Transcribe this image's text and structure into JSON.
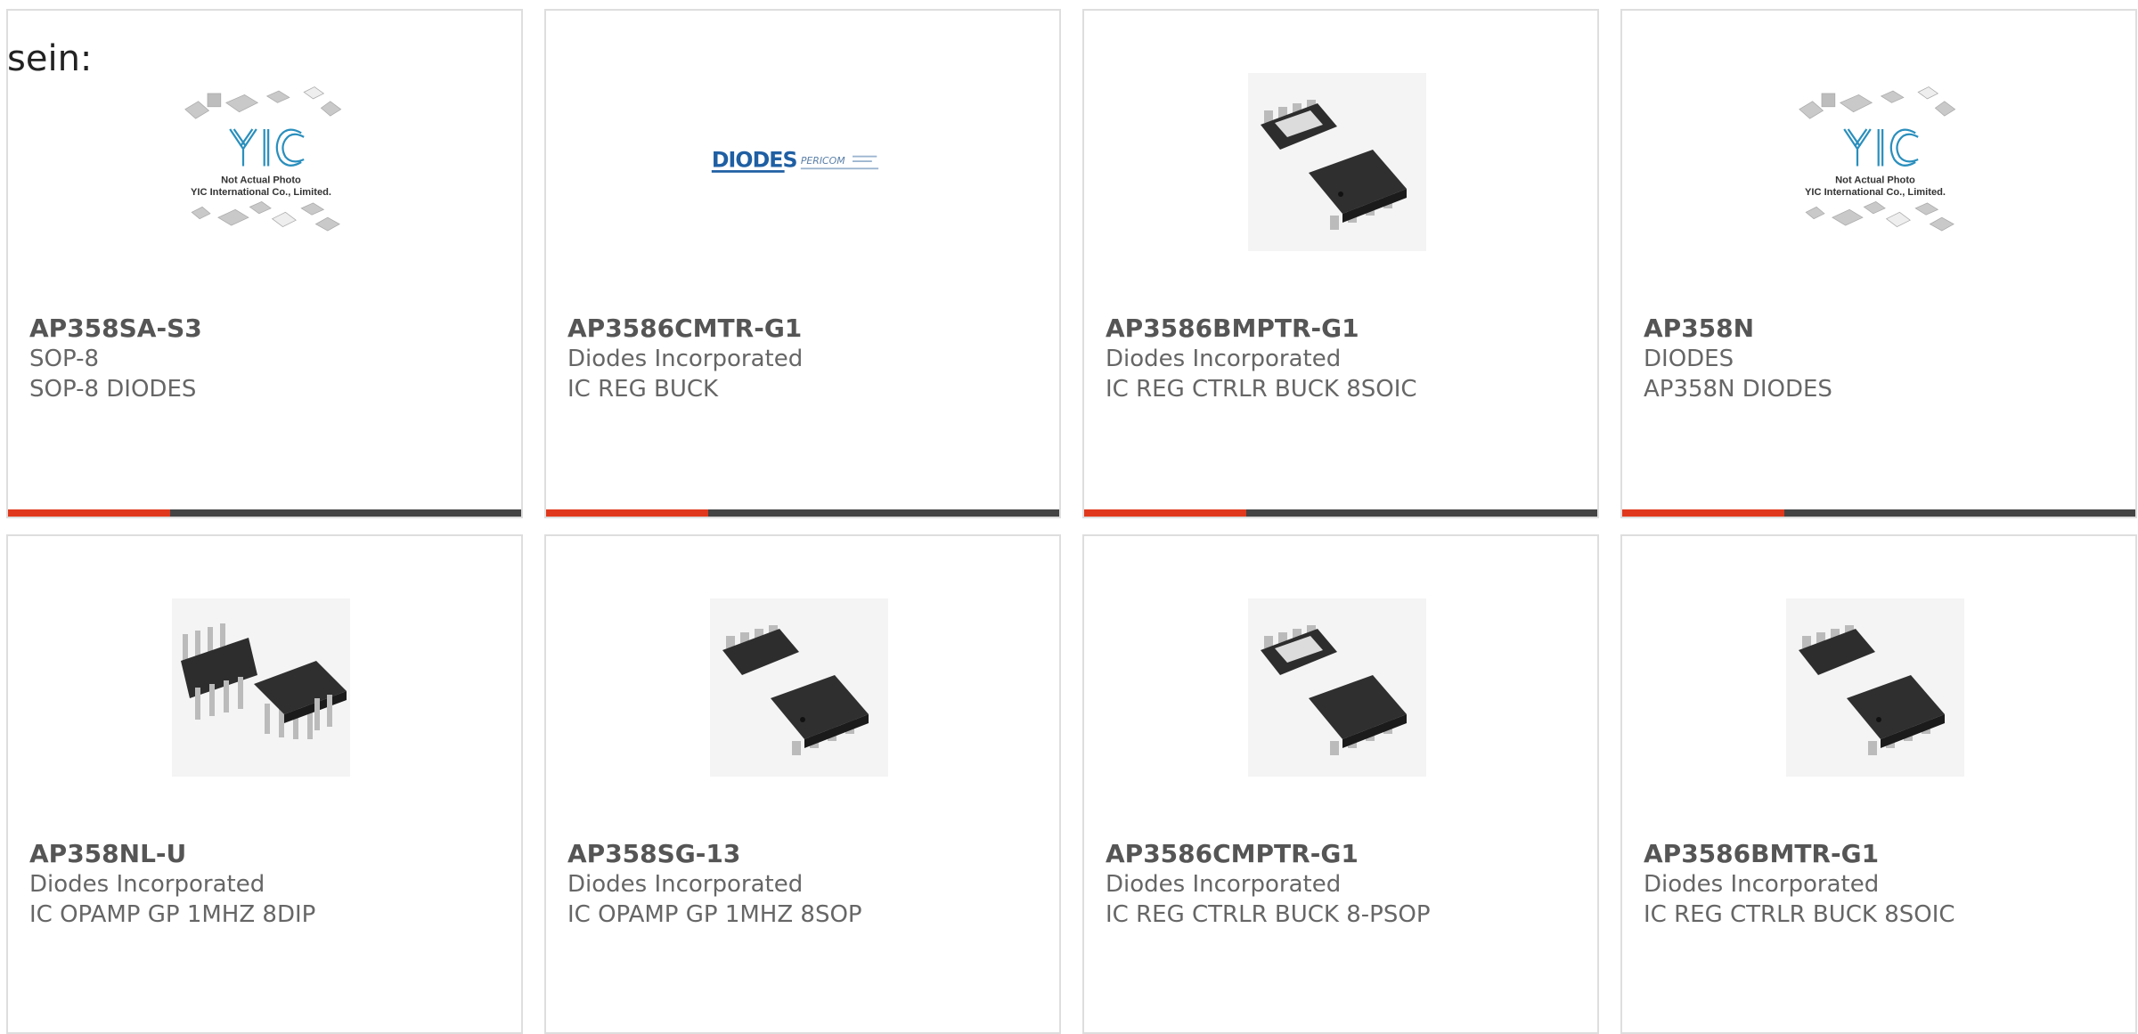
{
  "lead_text": "sein:",
  "products": [
    {
      "part": "AP358SA-S3",
      "line1": "SOP-8",
      "line2": "SOP-8 DIODES",
      "image": "yic-not-actual-photo",
      "image_caption_1": "Not Actual Photo",
      "image_caption_2": "YIC International Co., Limited."
    },
    {
      "part": "AP3586CMTR-G1",
      "line1": "Diodes Incorporated",
      "line2": "IC REG BUCK",
      "image": "diodes-pericom-logo",
      "logo_text_1": "DIODES",
      "logo_text_2": "PERICOM"
    },
    {
      "part": "AP3586BMPTR-G1",
      "line1": "Diodes Incorporated",
      "line2": "IC REG CTRLR BUCK 8SOIC",
      "image": "soic-8-chip-photo"
    },
    {
      "part": "AP358N",
      "line1": "DIODES",
      "line2": "AP358N DIODES",
      "image": "yic-not-actual-photo",
      "image_caption_1": "Not Actual Photo",
      "image_caption_2": "YIC International Co., Limited."
    },
    {
      "part": "AP358NL-U",
      "line1": "Diodes Incorporated",
      "line2": "IC OPAMP GP 1MHZ 8DIP",
      "image": "dip-8-chip-photo"
    },
    {
      "part": "AP358SG-13",
      "line1": "Diodes Incorporated",
      "line2": "IC OPAMP GP 1MHZ 8SOP",
      "image": "soic-8-chip-photo"
    },
    {
      "part": "AP3586CMPTR-G1",
      "line1": "Diodes Incorporated",
      "line2": "IC REG CTRLR BUCK 8-PSOP",
      "image": "soic-8-chip-photo"
    },
    {
      "part": "AP3586BMTR-G1",
      "line1": "Diodes Incorporated",
      "line2": "IC REG CTRLR BUCK 8SOIC",
      "image": "soic-8-chip-photo"
    }
  ],
  "colors": {
    "accent": "#e0381c",
    "bar": "#444444",
    "border": "#dedede",
    "title": "#555555",
    "text": "#666666",
    "logo_blue": "#1f5fa3"
  }
}
